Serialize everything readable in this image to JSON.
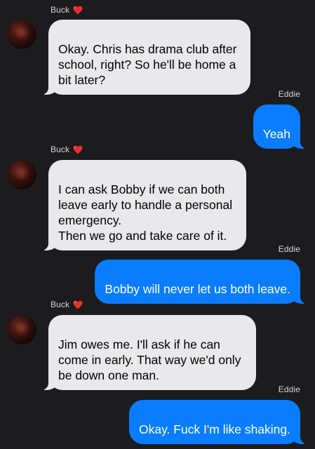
{
  "messages": [
    {
      "sender": "Buck",
      "direction": "incoming",
      "text": "Okay. Chris has drama club after\nschool, right? So he'll be home a\nbit later?"
    },
    {
      "sender": "Eddie",
      "direction": "outgoing",
      "text": "Yeah"
    },
    {
      "sender": "Buck",
      "direction": "incoming",
      "text": "I can ask Bobby if we can both\nleave early to handle a personal\nemergency.\nThen we go and take care of it."
    },
    {
      "sender": "Eddie",
      "direction": "outgoing",
      "text": "Bobby will never let us both leave."
    },
    {
      "sender": "Buck",
      "direction": "incoming",
      "text": "Jim owes me. I'll ask if he can\ncome in early. That way we'd only\nbe down one man."
    },
    {
      "sender": "Eddie",
      "direction": "outgoing",
      "text": "Okay. Fuck I'm like shaking."
    }
  ],
  "icons": {
    "heart": "red-heart-icon",
    "avatar": "contact-avatar-photo"
  },
  "colors": {
    "background": "#1c1c1e",
    "incoming_bubble": "#e9e9eb",
    "outgoing_bubble": "#0a7cff",
    "heart": "#e8302a"
  }
}
